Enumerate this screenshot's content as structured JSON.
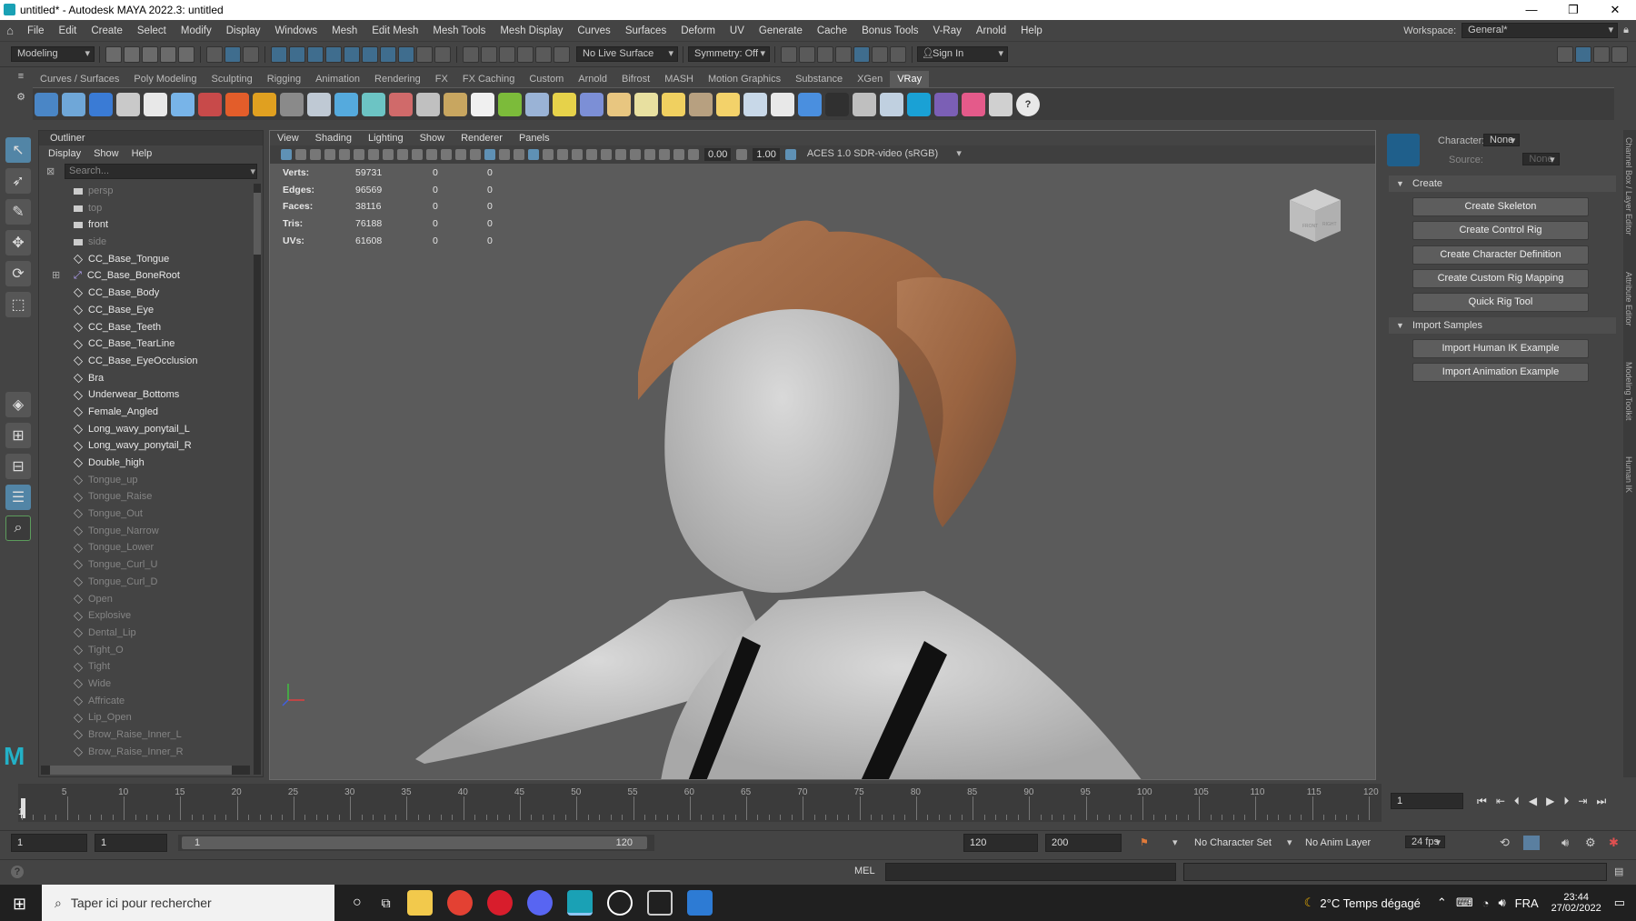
{
  "window": {
    "title": "untitled* - Autodesk MAYA 2022.3: untitled",
    "minimize_icon": "minimize-icon",
    "maximize_icon": "restore-icon",
    "close_icon": "close-icon"
  },
  "menubar": {
    "items": [
      "File",
      "Edit",
      "Create",
      "Select",
      "Modify",
      "Display",
      "Windows",
      "Mesh",
      "Edit Mesh",
      "Mesh Tools",
      "Mesh Display",
      "Curves",
      "Surfaces",
      "Deform",
      "UV",
      "Generate",
      "Cache",
      "Bonus Tools",
      "V-Ray",
      "Arnold",
      "Help"
    ],
    "workspace_label": "Workspace:",
    "workspace_value": "General*"
  },
  "statusline": {
    "mode": "Modeling",
    "live_surface": "No Live Surface",
    "symmetry": "Symmetry: Off",
    "sign_in": "Sign In"
  },
  "shelf": {
    "tabs": [
      "Curves / Surfaces",
      "Poly Modeling",
      "Sculpting",
      "Rigging",
      "Animation",
      "Rendering",
      "FX",
      "FX Caching",
      "Custom",
      "Arnold",
      "Bifrost",
      "MASH",
      "Motion Graphics",
      "Substance",
      "XGen",
      "VRay"
    ],
    "active_tab": "VRay",
    "icon_colors": [
      "#4a86c6",
      "#6fa7d8",
      "#3a7bd5",
      "#c9c9c9",
      "#e8e8e8",
      "#78b4e8",
      "#c84a4a",
      "#e35d2a",
      "#e0a020",
      "#8a8a8a",
      "#bfc9d4",
      "#55aadd",
      "#6cc4c4",
      "#d06a6a",
      "#c0c0c0",
      "#c8a660",
      "#f0f0f0",
      "#7cbb3a",
      "#9ab3d6",
      "#e6d24a",
      "#7c8fd6",
      "#e8c680",
      "#e8e0a0",
      "#f0d060",
      "#b7a080",
      "#f3d26a",
      "#c8d8e8",
      "#e8e8e8",
      "#4a8fdf",
      "#303030",
      "#bfbfbf",
      "#c0d0e0",
      "#1aa1d5",
      "#7b5fb5",
      "#e45a8a",
      "#d0d0d0"
    ]
  },
  "outliner": {
    "title": "Outliner",
    "menu": [
      "Display",
      "Show",
      "Help"
    ],
    "search_placeholder": "Search...",
    "items": [
      {
        "name": "persp",
        "type": "camera",
        "state": "grey"
      },
      {
        "name": "top",
        "type": "camera",
        "state": "grey"
      },
      {
        "name": "front",
        "type": "camera",
        "state": "white"
      },
      {
        "name": "side",
        "type": "camera",
        "state": "grey"
      },
      {
        "name": "CC_Base_Tongue",
        "type": "mesh",
        "state": "white"
      },
      {
        "name": "CC_Base_BoneRoot",
        "type": "joint",
        "state": "white"
      },
      {
        "name": "CC_Base_Body",
        "type": "mesh",
        "state": "white"
      },
      {
        "name": "CC_Base_Eye",
        "type": "mesh",
        "state": "white"
      },
      {
        "name": "CC_Base_Teeth",
        "type": "mesh",
        "state": "white"
      },
      {
        "name": "CC_Base_TearLine",
        "type": "mesh",
        "state": "white"
      },
      {
        "name": "CC_Base_EyeOcclusion",
        "type": "mesh",
        "state": "white"
      },
      {
        "name": "Bra",
        "type": "mesh",
        "state": "white"
      },
      {
        "name": "Underwear_Bottoms",
        "type": "mesh",
        "state": "white"
      },
      {
        "name": "Female_Angled",
        "type": "mesh",
        "state": "white"
      },
      {
        "name": "Long_wavy_ponytail_L",
        "type": "mesh",
        "state": "white"
      },
      {
        "name": "Long_wavy_ponytail_R",
        "type": "mesh",
        "state": "white"
      },
      {
        "name": "Double_high",
        "type": "mesh",
        "state": "white"
      },
      {
        "name": "Tongue_up",
        "type": "mesh",
        "state": "grey"
      },
      {
        "name": "Tongue_Raise",
        "type": "mesh",
        "state": "grey"
      },
      {
        "name": "Tongue_Out",
        "type": "mesh",
        "state": "grey"
      },
      {
        "name": "Tongue_Narrow",
        "type": "mesh",
        "state": "grey"
      },
      {
        "name": "Tongue_Lower",
        "type": "mesh",
        "state": "grey"
      },
      {
        "name": "Tongue_Curl_U",
        "type": "mesh",
        "state": "grey"
      },
      {
        "name": "Tongue_Curl_D",
        "type": "mesh",
        "state": "grey"
      },
      {
        "name": "Open",
        "type": "mesh",
        "state": "grey"
      },
      {
        "name": "Explosive",
        "type": "mesh",
        "state": "grey"
      },
      {
        "name": "Dental_Lip",
        "type": "mesh",
        "state": "grey"
      },
      {
        "name": "Tight_O",
        "type": "mesh",
        "state": "grey"
      },
      {
        "name": "Tight",
        "type": "mesh",
        "state": "grey"
      },
      {
        "name": "Wide",
        "type": "mesh",
        "state": "grey"
      },
      {
        "name": "Affricate",
        "type": "mesh",
        "state": "grey"
      },
      {
        "name": "Lip_Open",
        "type": "mesh",
        "state": "grey"
      },
      {
        "name": "Brow_Raise_Inner_L",
        "type": "mesh",
        "state": "grey"
      },
      {
        "name": "Brow_Raise_Inner_R",
        "type": "mesh",
        "state": "grey"
      }
    ]
  },
  "viewport": {
    "menu": [
      "View",
      "Shading",
      "Lighting",
      "Show",
      "Renderer",
      "Panels"
    ],
    "exposure": "0.00",
    "gamma": "1.00",
    "colorspace": "ACES 1.0 SDR-video (sRGB)",
    "hud": [
      {
        "label": "Verts:",
        "value": "59731",
        "sel": "0",
        "comp": "0"
      },
      {
        "label": "Edges:",
        "value": "96569",
        "sel": "0",
        "comp": "0"
      },
      {
        "label": "Faces:",
        "value": "38116",
        "sel": "0",
        "comp": "0"
      },
      {
        "label": "Tris:",
        "value": "76188",
        "sel": "0",
        "comp": "0"
      },
      {
        "label": "UVs:",
        "value": "61608",
        "sel": "0",
        "comp": "0"
      }
    ],
    "viewcube_front": "FRONT",
    "viewcube_right": "RIGHT"
  },
  "hik": {
    "character_label": "Character:",
    "character_value": "None",
    "source_label": "Source:",
    "source_value": "None",
    "create_section": "Create",
    "create_buttons": [
      "Create Skeleton",
      "Create Control Rig",
      "Create Character Definition",
      "Create Custom Rig Mapping",
      "Quick Rig Tool"
    ],
    "import_section": "Import Samples",
    "import_buttons": [
      "Import Human IK Example",
      "Import Animation Example"
    ],
    "side_tabs": [
      "Channel Box / Layer Editor",
      "Attribute Editor",
      "Modeling Toolkit",
      "Human IK"
    ]
  },
  "timeline": {
    "labels": [
      "5",
      "10",
      "15",
      "20",
      "25",
      "30",
      "35",
      "40",
      "45",
      "50",
      "55",
      "60",
      "65",
      "70",
      "75",
      "80",
      "85",
      "90",
      "95",
      "100",
      "105",
      "110",
      "115",
      "120"
    ],
    "current_frame": "1",
    "current_frame_field": "1"
  },
  "range": {
    "start": "1",
    "playback_start": "1",
    "slider_start": "1",
    "slider_end": "120",
    "playback_end": "120",
    "end": "200",
    "character_set": "No Character Set",
    "anim_layer": "No Anim Layer",
    "fps": "24 fps"
  },
  "cmdline": {
    "lang": "MEL"
  },
  "taskbar": {
    "search_placeholder": "Taper ici pour rechercher",
    "weather": "2°C  Temps dégagé",
    "lang": "FRA",
    "time": "23:44",
    "date": "27/02/2022"
  }
}
